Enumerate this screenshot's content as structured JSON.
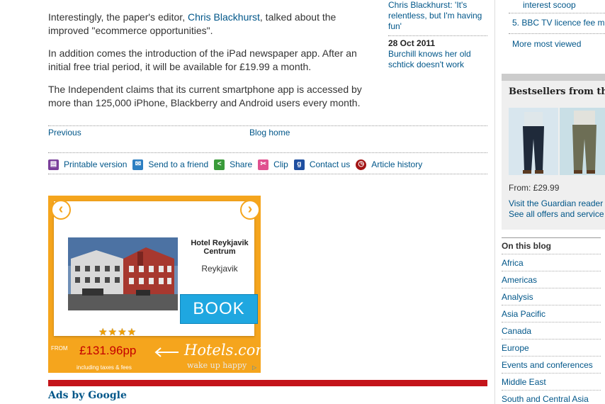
{
  "article": {
    "p1_before": "Interestingly, the paper's editor, ",
    "p1_link": "Chris Blackhurst",
    "p1_after": ", talked about the improved \"ecommerce opportunities\".",
    "p2": "In addition comes the introduction of the iPad newspaper app. After an initial free trial period, it will be available for £19.99 a month.",
    "p3": "The Independent claims that its current smartphone app is accessed by more than 125,000 iPhone, Blackberry and Android users every month."
  },
  "nav": {
    "previous": "Previous",
    "blog_home": "Blog home"
  },
  "tools": [
    {
      "label": "Printable version",
      "icon": "printer-icon",
      "color": "#7a3f9a"
    },
    {
      "label": "Send to a friend",
      "icon": "envelope-icon",
      "color": "#2d7fc2"
    },
    {
      "label": "Share",
      "icon": "share-icon",
      "color": "#3a9b3a"
    },
    {
      "label": "Clip",
      "icon": "scissors-icon",
      "color": "#e0508f"
    },
    {
      "label": "Contact us",
      "icon": "contact-icon",
      "color": "#1f4fa0"
    },
    {
      "label": "Article history",
      "icon": "clock-icon",
      "color": "#a31515"
    }
  ],
  "ad": {
    "hotel_name": "Hotel Reykjavik Centrum",
    "city": "Reykjavik",
    "book": "BOOK",
    "stars": "★★★★",
    "from": "FROM",
    "price": "£131.96pp",
    "fees": "including taxes & fees",
    "brand": "Hotels.com",
    "tagline": "wake up happy",
    "prev_arrow": "‹",
    "next_arrow": "›",
    "adchoices": "▷"
  },
  "ads_by_google": "Ads by Google",
  "related": {
    "item1": "Chris Blackhurst: 'It's relentless, but I'm having fun'",
    "date2": "28 Oct 2011",
    "item2": "Burchill knows her old schtick doesn't work"
  },
  "most_viewed": {
    "item4_tail": "interest scoop",
    "item5": "5. BBC TV licence fee m",
    "more": "More most viewed"
  },
  "bestsellers": {
    "title": "Bestsellers from th",
    "price": "From: £29.99",
    "visit": "Visit the Guardian reader",
    "see_all": "See all offers and service"
  },
  "on_this_blog": {
    "heading": "On this blog",
    "items": [
      "Africa",
      "Americas",
      "Analysis",
      "Asia Pacific",
      "Canada",
      "Europe",
      "Events and conferences",
      "Middle East",
      "South and Central Asia"
    ]
  },
  "colors": {
    "link": "#005689",
    "accent_red": "#c4141a",
    "ad_orange": "#f5a51d",
    "book_blue": "#1fa7e0"
  }
}
